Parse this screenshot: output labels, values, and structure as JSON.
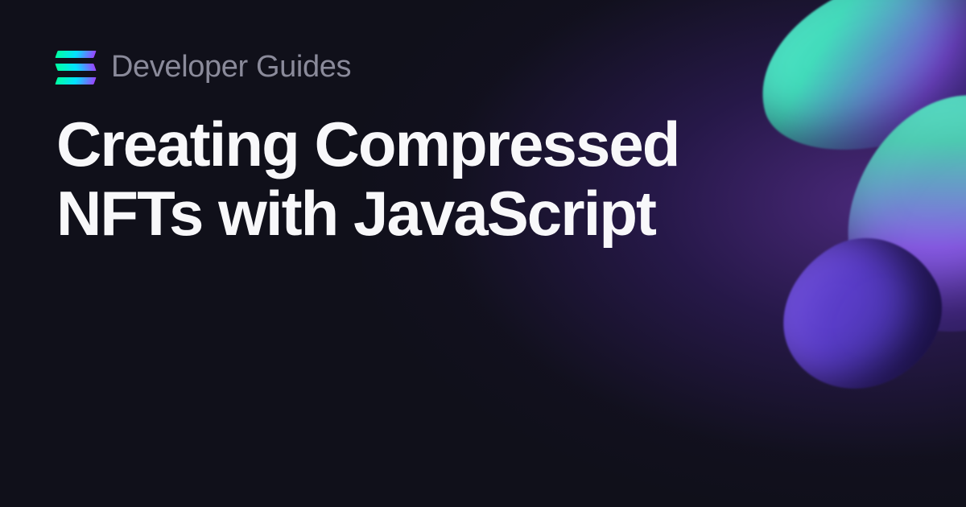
{
  "header": {
    "category": "Developer Guides"
  },
  "main": {
    "title": "Creating Compressed NFTs with JavaScript"
  }
}
